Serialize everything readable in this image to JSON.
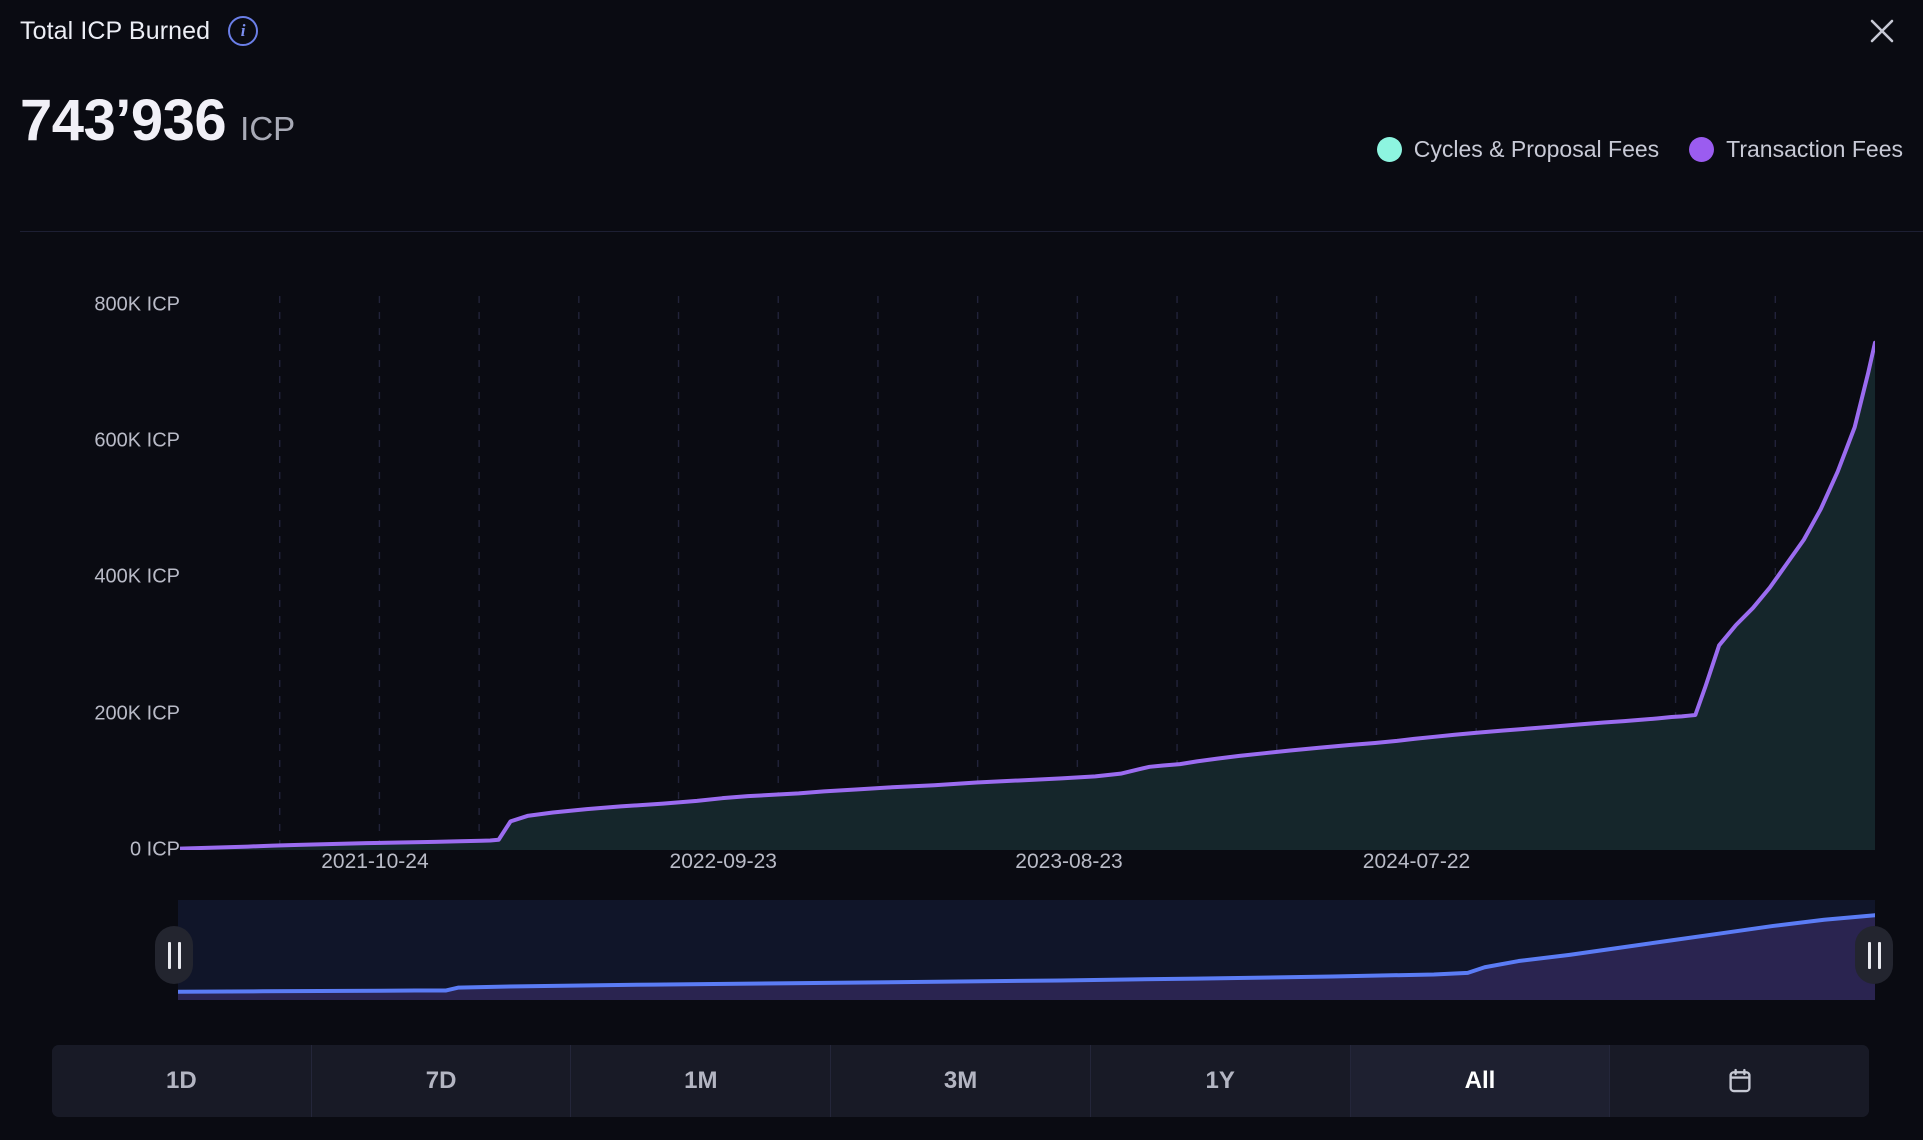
{
  "header": {
    "title": "Total ICP Burned",
    "info_icon": "info-icon",
    "info_glyph": "i",
    "close_icon": "close-icon"
  },
  "summary": {
    "value": "743’936",
    "unit": "ICP"
  },
  "legend": [
    {
      "label": "Cycles & Proposal Fees",
      "color": "#8df5e0"
    },
    {
      "label": "Transaction Fees",
      "color": "#9b5cf0"
    }
  ],
  "range_buttons": [
    {
      "label": "1D",
      "active": false
    },
    {
      "label": "7D",
      "active": false
    },
    {
      "label": "1M",
      "active": false
    },
    {
      "label": "3M",
      "active": false
    },
    {
      "label": "1Y",
      "active": false
    },
    {
      "label": "All",
      "active": true
    },
    {
      "label": "",
      "icon": "calendar-icon",
      "active": false
    }
  ],
  "brush": {
    "left_handle": "brush-handle-left",
    "right_handle": "brush-handle-right",
    "line_color": "#5b7cf5",
    "fill_color": "#2a2450"
  },
  "chart_data": {
    "type": "area",
    "title": "Total ICP Burned",
    "xlabel": "",
    "ylabel": "ICP",
    "ylim": [
      0,
      880000
    ],
    "grid": true,
    "legend_position": "top-right",
    "y_ticks": [
      {
        "value": 800000,
        "label": "800K ICP"
      },
      {
        "value": 600000,
        "label": "600K ICP"
      },
      {
        "value": 400000,
        "label": "400K ICP"
      },
      {
        "value": 200000,
        "label": "200K ICP"
      },
      {
        "value": 0,
        "label": "0 ICP"
      }
    ],
    "x_ticks": [
      {
        "pos": 0.115,
        "label": "2021-10-24"
      },
      {
        "pos": 0.3205,
        "label": "2022-09-23"
      },
      {
        "pos": 0.5245,
        "label": "2023-08-23"
      },
      {
        "pos": 0.7295,
        "label": "2024-07-22"
      }
    ],
    "line_color": "#9b6cf0",
    "fill_color": "#15262b",
    "series": [
      {
        "name": "Transaction Fees",
        "color": "#9b6cf0",
        "x": [
          0.0,
          0.02,
          0.04,
          0.055,
          0.07,
          0.09,
          0.11,
          0.13,
          0.15,
          0.165,
          0.178,
          0.183,
          0.188,
          0.195,
          0.205,
          0.22,
          0.24,
          0.26,
          0.285,
          0.305,
          0.32,
          0.335,
          0.35,
          0.365,
          0.38,
          0.4,
          0.42,
          0.445,
          0.47,
          0.495,
          0.52,
          0.54,
          0.555,
          0.565,
          0.572,
          0.58,
          0.59,
          0.6,
          0.612,
          0.625,
          0.64,
          0.655,
          0.672,
          0.69,
          0.705,
          0.718,
          0.728,
          0.74,
          0.752,
          0.765,
          0.78,
          0.795,
          0.81,
          0.825,
          0.84,
          0.852,
          0.862,
          0.872,
          0.88,
          0.886,
          0.89,
          0.894,
          0.9,
          0.908,
          0.918,
          0.928,
          0.938,
          0.948,
          0.958,
          0.968,
          0.978,
          0.988,
          0.996,
          1.0
        ],
        "y": [
          2000,
          3500,
          5000,
          6500,
          7500,
          8800,
          10000,
          11000,
          12000,
          12800,
          13500,
          14000,
          15000,
          42000,
          50000,
          55000,
          60000,
          64000,
          68000,
          72000,
          76000,
          79000,
          81000,
          83000,
          86000,
          89000,
          92000,
          95000,
          99000,
          102000,
          105000,
          108000,
          112000,
          118000,
          122000,
          124000,
          126000,
          130000,
          134000,
          138000,
          142000,
          146000,
          150000,
          154000,
          157000,
          160000,
          163000,
          166000,
          169000,
          172000,
          175000,
          178000,
          181000,
          184000,
          187000,
          189000,
          191000,
          193000,
          195000,
          196000,
          197000,
          198000,
          240000,
          300000,
          330000,
          355000,
          385000,
          420000,
          455000,
          500000,
          555000,
          620000,
          700000,
          744000
        ]
      }
    ],
    "brush_series": {
      "name": "Total ICP Burned (overview)",
      "color": "#5b7cf5",
      "x": [
        0.0,
        0.05,
        0.1,
        0.14,
        0.158,
        0.165,
        0.2,
        0.28,
        0.36,
        0.44,
        0.52,
        0.6,
        0.68,
        0.74,
        0.76,
        0.77,
        0.79,
        0.82,
        0.85,
        0.88,
        0.91,
        0.94,
        0.97,
        1.0
      ],
      "y": [
        2000,
        7000,
        11000,
        14000,
        15000,
        42000,
        55000,
        72000,
        85000,
        98000,
        112000,
        130000,
        150000,
        170000,
        185000,
        240000,
        300000,
        360000,
        430000,
        500000,
        570000,
        640000,
        700000,
        744000
      ]
    }
  }
}
